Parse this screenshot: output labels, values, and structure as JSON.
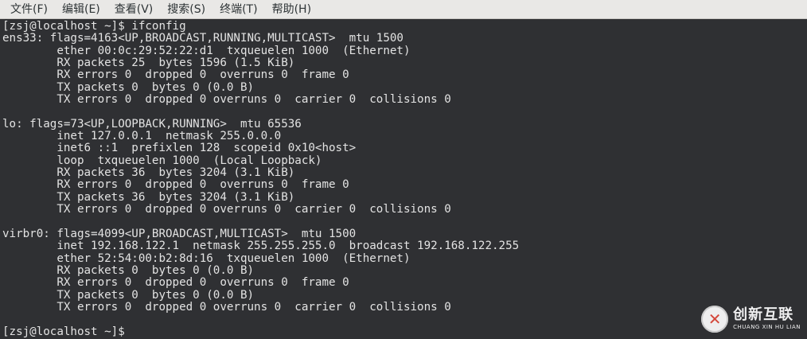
{
  "menu": {
    "items": [
      {
        "label": "文件(F)"
      },
      {
        "label": "编辑(E)"
      },
      {
        "label": "查看(V)"
      },
      {
        "label": "搜索(S)"
      },
      {
        "label": "终端(T)"
      },
      {
        "label": "帮助(H)"
      }
    ]
  },
  "terminal": {
    "lines": [
      "[zsj@localhost ~]$ ifconfig",
      "ens33: flags=4163<UP,BROADCAST,RUNNING,MULTICAST>  mtu 1500",
      "        ether 00:0c:29:52:22:d1  txqueuelen 1000  (Ethernet)",
      "        RX packets 25  bytes 1596 (1.5 KiB)",
      "        RX errors 0  dropped 0  overruns 0  frame 0",
      "        TX packets 0  bytes 0 (0.0 B)",
      "        TX errors 0  dropped 0 overruns 0  carrier 0  collisions 0",
      "",
      "lo: flags=73<UP,LOOPBACK,RUNNING>  mtu 65536",
      "        inet 127.0.0.1  netmask 255.0.0.0",
      "        inet6 ::1  prefixlen 128  scopeid 0x10<host>",
      "        loop  txqueuelen 1000  (Local Loopback)",
      "        RX packets 36  bytes 3204 (3.1 KiB)",
      "        RX errors 0  dropped 0  overruns 0  frame 0",
      "        TX packets 36  bytes 3204 (3.1 KiB)",
      "        TX errors 0  dropped 0 overruns 0  carrier 0  collisions 0",
      "",
      "virbr0: flags=4099<UP,BROADCAST,MULTICAST>  mtu 1500",
      "        inet 192.168.122.1  netmask 255.255.255.0  broadcast 192.168.122.255",
      "        ether 52:54:00:b2:8d:16  txqueuelen 1000  (Ethernet)",
      "        RX packets 0  bytes 0 (0.0 B)",
      "        RX errors 0  dropped 0  overruns 0  frame 0",
      "        TX packets 0  bytes 0 (0.0 B)",
      "        TX errors 0  dropped 0 overruns 0  carrier 0  collisions 0",
      "",
      "[zsj@localhost ~]$ "
    ]
  },
  "watermark": {
    "main": "创新互联",
    "sub": "CHUANG XIN HU LIAN"
  },
  "colors": {
    "terminal_bg": "#2f3033",
    "terminal_fg": "#e3e3e3",
    "menubar_bg": "#e9e8e6",
    "menubar_fg": "#2e3436"
  }
}
